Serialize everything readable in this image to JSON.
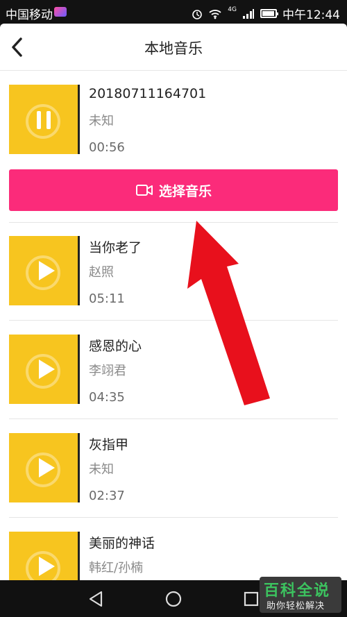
{
  "status_bar": {
    "carrier": "中国移动",
    "network": "4G",
    "time": "中午12:44"
  },
  "header": {
    "title": "本地音乐",
    "back_icon": "chevron-left-icon"
  },
  "current_song": {
    "name": "20180711164701",
    "artist": "未知",
    "duration": "00:56",
    "state_icon": "pause-icon"
  },
  "select_button": {
    "label": "选择音乐",
    "icon": "video-camera-icon"
  },
  "songs": [
    {
      "name": "当你老了",
      "artist": "赵照",
      "duration": "05:11"
    },
    {
      "name": "感恩的心",
      "artist": "李翊君",
      "duration": "04:35"
    },
    {
      "name": "灰指甲",
      "artist": "未知",
      "duration": "02:37"
    },
    {
      "name": "美丽的神话",
      "artist": "韩红/孙楠",
      "duration": ""
    }
  ],
  "colors": {
    "accent": "#fb2b7a",
    "cover": "#f7c51f",
    "annotation_arrow": "#e8101c"
  },
  "watermark": {
    "main": "百科全说",
    "sub": "助你轻松解决"
  }
}
